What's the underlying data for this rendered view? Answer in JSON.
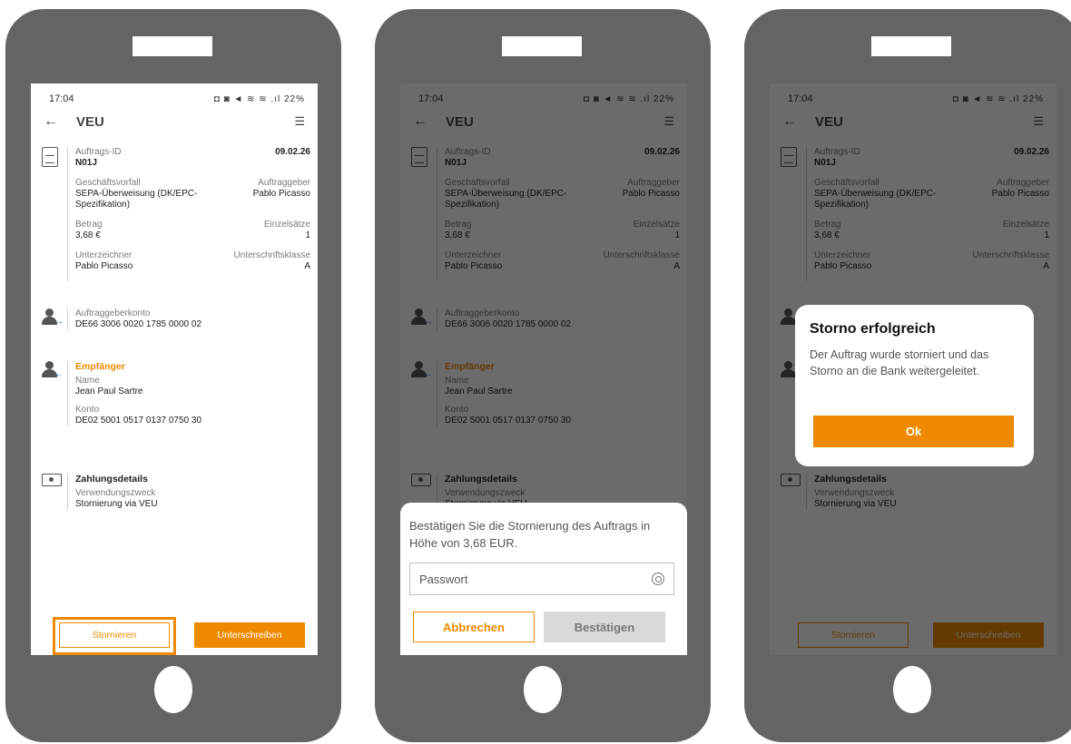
{
  "status": {
    "time": "17:04",
    "icons": "◘ ◙ ◄ ≋ ≋ .ıl",
    "battery": "22%"
  },
  "appbar": {
    "back": "←",
    "title": "VEU",
    "menu": "☰"
  },
  "order": {
    "id_label": "Auftrags-ID",
    "id_value": "N01J",
    "date": "09.02.26",
    "case_label": "Geschäftsvorfall",
    "case_value": "SEPA-Überweisung (DK/EPC-Spezifikation)",
    "orderer_label": "Auftraggeber",
    "orderer_value": "Pablo Picasso",
    "amount_label": "Betrag",
    "amount_value": "3,68 €",
    "records_label": "Einzelsätze",
    "records_value": "1",
    "signer_label": "Unterzeichner",
    "signer_value": "Pablo Picasso",
    "sigclass_label": "Unterschriftsklasse",
    "sigclass_value": "A"
  },
  "account": {
    "label": "Auftraggeberkonto",
    "value": "DE66 3006 0020 1785 0000 02"
  },
  "recipient": {
    "title": "Empfänger",
    "name_label": "Name",
    "name_value": "Jean Paul Sartre",
    "account_label": "Konto",
    "account_value": "DE02 5001 0517 0137 0750 30"
  },
  "payment": {
    "title": "Zahlungsdetails",
    "purpose_label": "Verwendungszweck",
    "purpose_value": "Stornierung via VEU"
  },
  "actions": {
    "cancel": "Stornieren",
    "sign": "Unterschreiben"
  },
  "confirm_sheet": {
    "message": "Bestätigen Sie die Stornierung des Auftrags in Höhe von 3,68 EUR.",
    "password_placeholder": "Passwort",
    "cancel": "Abbrechen",
    "confirm": "Bestätigen"
  },
  "success_dialog": {
    "title": "Storno erfolgreich",
    "message": "Der Auftrag wurde storniert und das Storno an die Bank weitergeleitet.",
    "ok": "Ok"
  },
  "colors": {
    "accent": "#ef8a00",
    "phone": "#646464"
  }
}
